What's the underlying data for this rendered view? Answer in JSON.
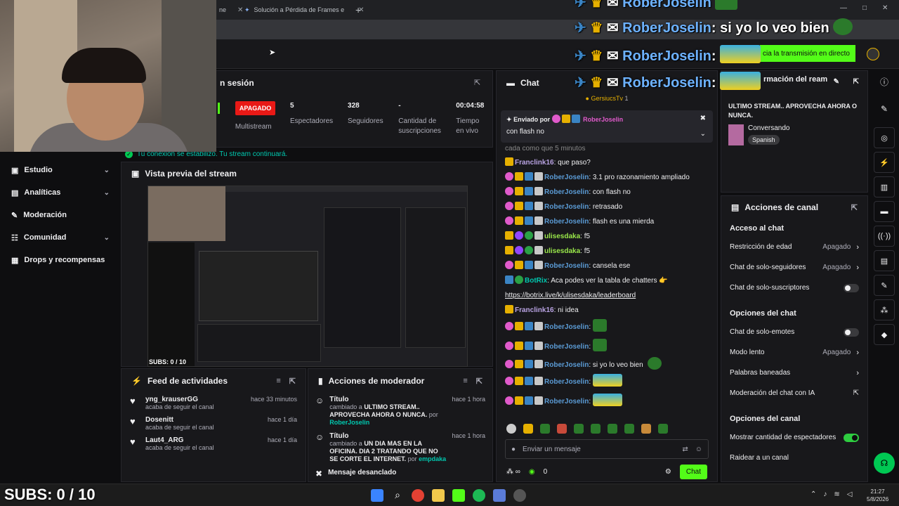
{
  "browser": {
    "tabs": [
      {
        "label": "ne"
      },
      {
        "label": "Solución a Pérdida de Frames e"
      }
    ],
    "new_tab": "+"
  },
  "dashboard": {
    "session_label": "n sesión",
    "status_badge": "APAGADO",
    "stats": [
      {
        "value": "",
        "label": "Multistream"
      },
      {
        "value": "5",
        "label": "Espectadores"
      },
      {
        "value": "328",
        "label": "Seguidores"
      },
      {
        "value": "-",
        "label": "Cantidad de suscripciones"
      },
      {
        "value": "00:04:58",
        "label": "Tiempo en vivo"
      }
    ],
    "connection_notice": "Tu conexión se estabilizó. Tu stream continuará.",
    "start_button": "cia la transmisión en directo"
  },
  "sidebar": {
    "items": [
      {
        "label": "Estudio",
        "icon": "camera-icon",
        "expand": true
      },
      {
        "label": "Analíticas",
        "icon": "chart-icon",
        "expand": true
      },
      {
        "label": "Moderación",
        "icon": "wrench-icon",
        "expand": false
      },
      {
        "label": "Comunidad",
        "icon": "people-icon",
        "expand": true
      },
      {
        "label": "Drops y recompensas",
        "icon": "gift-icon",
        "expand": false
      }
    ]
  },
  "preview": {
    "title": "Vista previa del stream",
    "subs_overlay": "SUBS: 0 / 10"
  },
  "activity_feed": {
    "title": "Feed de actividades",
    "items": [
      {
        "name": "yng_krauserGG",
        "action": "acaba de seguir el canal",
        "time": "hace 33 minutos"
      },
      {
        "name": "Dosenitt",
        "action": "acaba de seguir el canal",
        "time": "hace 1 día"
      },
      {
        "name": "Laut4_ARG",
        "action": "acaba de seguir el canal",
        "time": "hace 1 día"
      }
    ]
  },
  "mod_actions": {
    "title": "Acciones de moderador",
    "items": [
      {
        "title": "Título",
        "prefix": "cambiado a",
        "value": "ULTIMO STREAM.. APROVECHA AHORA O NUNCA.",
        "by_label": "por",
        "by": "RoberJoselin",
        "time": "hace 1 hora"
      },
      {
        "title": "Título",
        "prefix": "cambiado a",
        "value": "UN DIA MAS EN LA OFICINA. DIA 2 TRATANDO QUE NO SE CORTE EL INTERNET.",
        "by_label": "por",
        "by": "empdaka",
        "time": "hace 1 hora"
      },
      {
        "title": "Mensaje desanclado",
        "prefix": "",
        "value": "",
        "by_label": "",
        "by": "",
        "time": ""
      }
    ]
  },
  "chat": {
    "title": "Chat",
    "gift_user": "GersiucsTv",
    "gift_count": "1",
    "pinned": {
      "sent_by": "Enviado por",
      "user": "RoberJoselin",
      "text": "con flash no"
    },
    "hidden_line": "cada como que 5 minutos",
    "messages": [
      {
        "user": "Franclink16",
        "color": "#b9a3e3",
        "text": "que paso?",
        "badges": [
          "y"
        ]
      },
      {
        "user": "RoberJoselin",
        "color": "#5b9bd5",
        "text": "3.1 pro razonamiento ampliado",
        "badges": [
          "p",
          "y",
          "b",
          "w"
        ]
      },
      {
        "user": "RoberJoselin",
        "color": "#5b9bd5",
        "text": "con flash no",
        "badges": [
          "p",
          "y",
          "b",
          "w"
        ]
      },
      {
        "user": "RoberJoselin",
        "color": "#5b9bd5",
        "text": "retrasado",
        "badges": [
          "p",
          "y",
          "b",
          "w"
        ]
      },
      {
        "user": "RoberJoselin",
        "color": "#5b9bd5",
        "text": "flash es una mierda",
        "badges": [
          "p",
          "y",
          "b",
          "w"
        ]
      },
      {
        "user": "ulisesdaka",
        "color": "#9ae84a",
        "text": "f5",
        "badges": [
          "k",
          "m",
          "g",
          "w"
        ]
      },
      {
        "user": "ulisesdaka",
        "color": "#9ae84a",
        "text": "f5",
        "badges": [
          "k",
          "m",
          "g",
          "w"
        ]
      },
      {
        "user": "RoberJoselin",
        "color": "#5b9bd5",
        "text": "cansela ese",
        "badges": [
          "p",
          "y",
          "b",
          "w"
        ]
      },
      {
        "user": "BotRix",
        "color": "#00c8af",
        "text": "Aca podes ver la tabla de chatters 👉",
        "badges": [
          "b",
          "g"
        ]
      },
      {
        "user": "",
        "color": "#efeff1",
        "text": "https://botrix.live/k/ulisesdaka/leaderboard",
        "badges": []
      },
      {
        "user": "Franclink16",
        "color": "#b9a3e3",
        "text": "ni idea",
        "badges": [
          "y"
        ]
      },
      {
        "user": "RoberJoselin",
        "color": "#5b9bd5",
        "text": "",
        "badges": [
          "p",
          "y",
          "b",
          "w"
        ],
        "emote": "green"
      },
      {
        "user": "RoberJoselin",
        "color": "#5b9bd5",
        "text": "",
        "badges": [
          "p",
          "y",
          "b",
          "w"
        ],
        "emote": "green"
      },
      {
        "user": "RoberJoselin",
        "color": "#5b9bd5",
        "text": "si yo lo veo bien",
        "badges": [
          "p",
          "y",
          "b",
          "w"
        ],
        "emote": "frog"
      },
      {
        "user": "RoberJoselin",
        "color": "#5b9bd5",
        "text": "",
        "badges": [
          "p",
          "y",
          "b",
          "w"
        ],
        "emote": "car"
      },
      {
        "user": "RoberJoselin",
        "color": "#5b9bd5",
        "text": "",
        "badges": [
          "p",
          "y",
          "b",
          "w"
        ],
        "emote": "car"
      }
    ],
    "input_placeholder": "Enviar un mensaje",
    "points": "0",
    "send_button": "Chat"
  },
  "overlay": {
    "lines": [
      {
        "user": "RoberJoselin",
        "text": ""
      },
      {
        "user": "RoberJoselin",
        "text": "si yo lo veo bien"
      },
      {
        "user": "RoberJoselin",
        "text": ""
      },
      {
        "user": "RoberJoselin",
        "text": ""
      }
    ],
    "subs_big": "SUBS: 0 / 10"
  },
  "channel_info": {
    "title": "rmación del ream",
    "stream_title": "ULTIMO STREAM.. APROVECHA AHORA O NUNCA.",
    "category": "Conversando",
    "tag": "Spanish"
  },
  "channel_actions": {
    "title": "Acciones de canal",
    "sections": [
      {
        "heading": "Acceso al chat",
        "rows": [
          {
            "label": "Restricción de edad",
            "value": "Apagado",
            "type": "chevron"
          },
          {
            "label": "Chat de solo-seguidores",
            "value": "Apagado",
            "type": "chevron"
          },
          {
            "label": "Chat de solo-suscriptores",
            "value": "",
            "type": "toggle-off"
          }
        ]
      },
      {
        "heading": "Opciones del chat",
        "rows": [
          {
            "label": "Chat de solo-emotes",
            "value": "",
            "type": "toggle-off"
          },
          {
            "label": "Modo lento",
            "value": "Apagado",
            "type": "chevron"
          },
          {
            "label": "Palabras baneadas",
            "value": "",
            "type": "chevron"
          },
          {
            "label": "Moderación del chat con IA",
            "value": "",
            "type": "external"
          }
        ]
      },
      {
        "heading": "Opciones del canal",
        "rows": [
          {
            "label": "Mostrar cantidad de espectadores",
            "value": "",
            "type": "toggle-on"
          },
          {
            "label": "Raidear a un canal",
            "value": "",
            "type": "none"
          }
        ]
      }
    ]
  },
  "taskbar": {
    "time": "21:27",
    "date": "5/8/2026"
  },
  "colors": {
    "accent_green": "#53fc18",
    "live_red": "#e91916",
    "teal": "#00c8af",
    "overlay_blue": "#6db2ff"
  }
}
